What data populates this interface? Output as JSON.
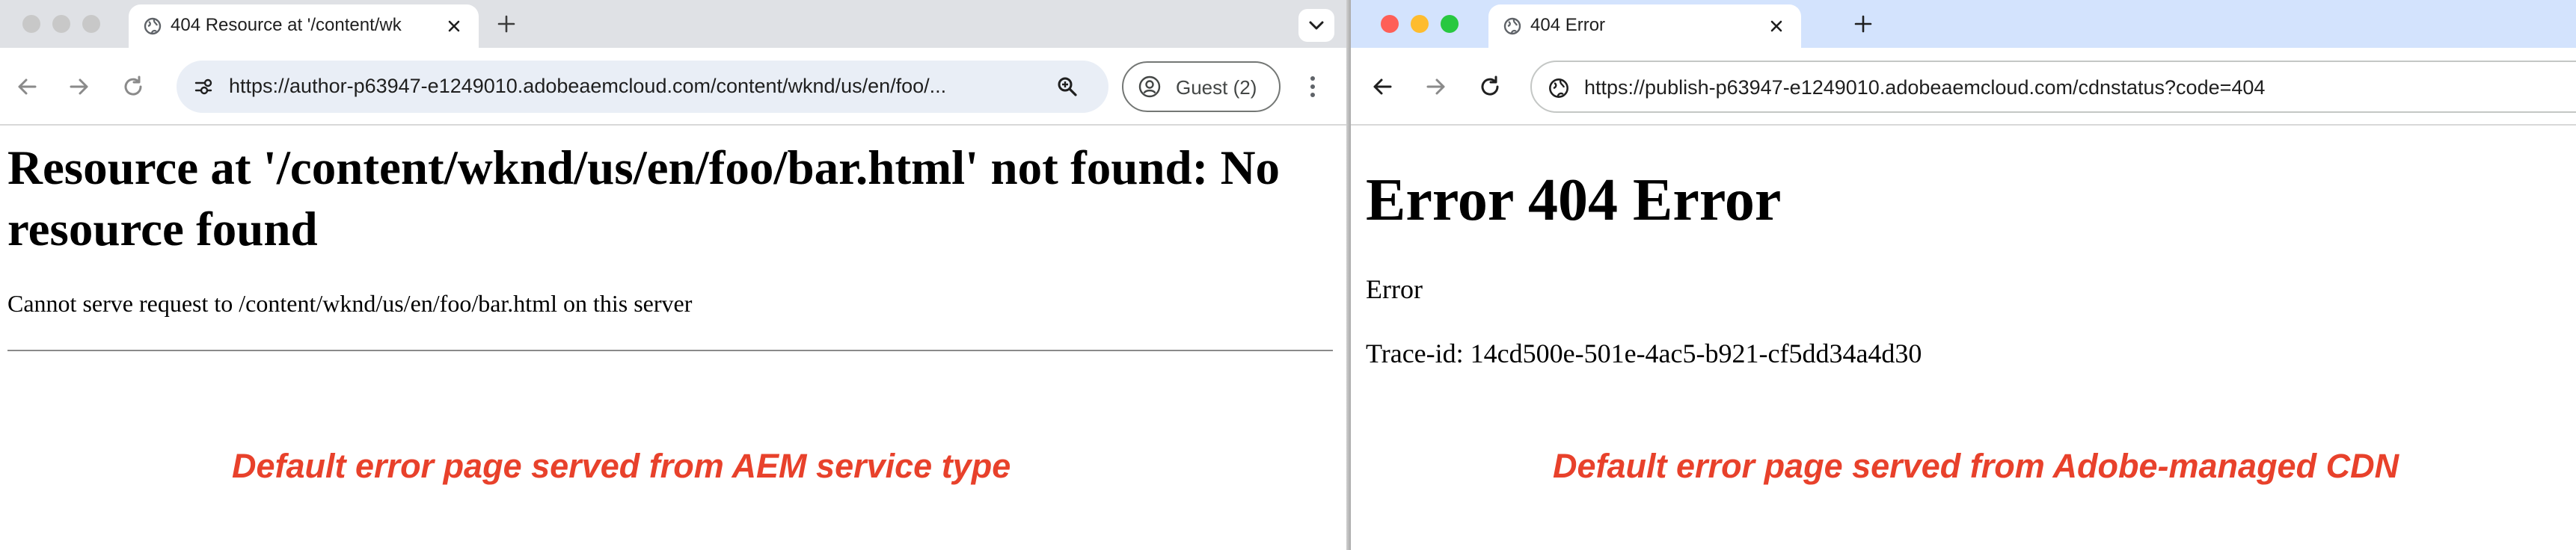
{
  "colors": {
    "caption": "#e8412b",
    "left_tabstrip": "#dfe1e5",
    "right_tabstrip": "#d3e3fd",
    "traffic_close": "#fe5f57",
    "traffic_minimize": "#febc2e",
    "traffic_maximize": "#28c840"
  },
  "left": {
    "tab": {
      "title": "404 Resource at '/content/wk",
      "icon": "globe-icon"
    },
    "address": {
      "url": "https://author-p63947-e1249010.adobeaemcloud.com/content/wknd/us/en/foo/...",
      "icon": "site-settings-icon"
    },
    "profile": {
      "label": "Guest (2)",
      "icon": "person-icon"
    },
    "page": {
      "heading": "Resource at '/content/wknd/us/en/foo/bar.html' not found: No resource found",
      "message": "Cannot serve request to /content/wknd/us/en/foo/bar.html on this server"
    },
    "caption": "Default error page served from AEM service type"
  },
  "right": {
    "tab": {
      "title": "404 Error",
      "icon": "globe-icon"
    },
    "address": {
      "url": "https://publish-p63947-e1249010.adobeaemcloud.com/cdnstatus?code=404",
      "icon": "globe-icon"
    },
    "page": {
      "heading": "Error 404 Error",
      "line1": "Error",
      "line2": "Trace-id: 14cd500e-501e-4ac5-b921-cf5dd34a4d30"
    },
    "caption": "Default error page served from Adobe-managed CDN"
  }
}
